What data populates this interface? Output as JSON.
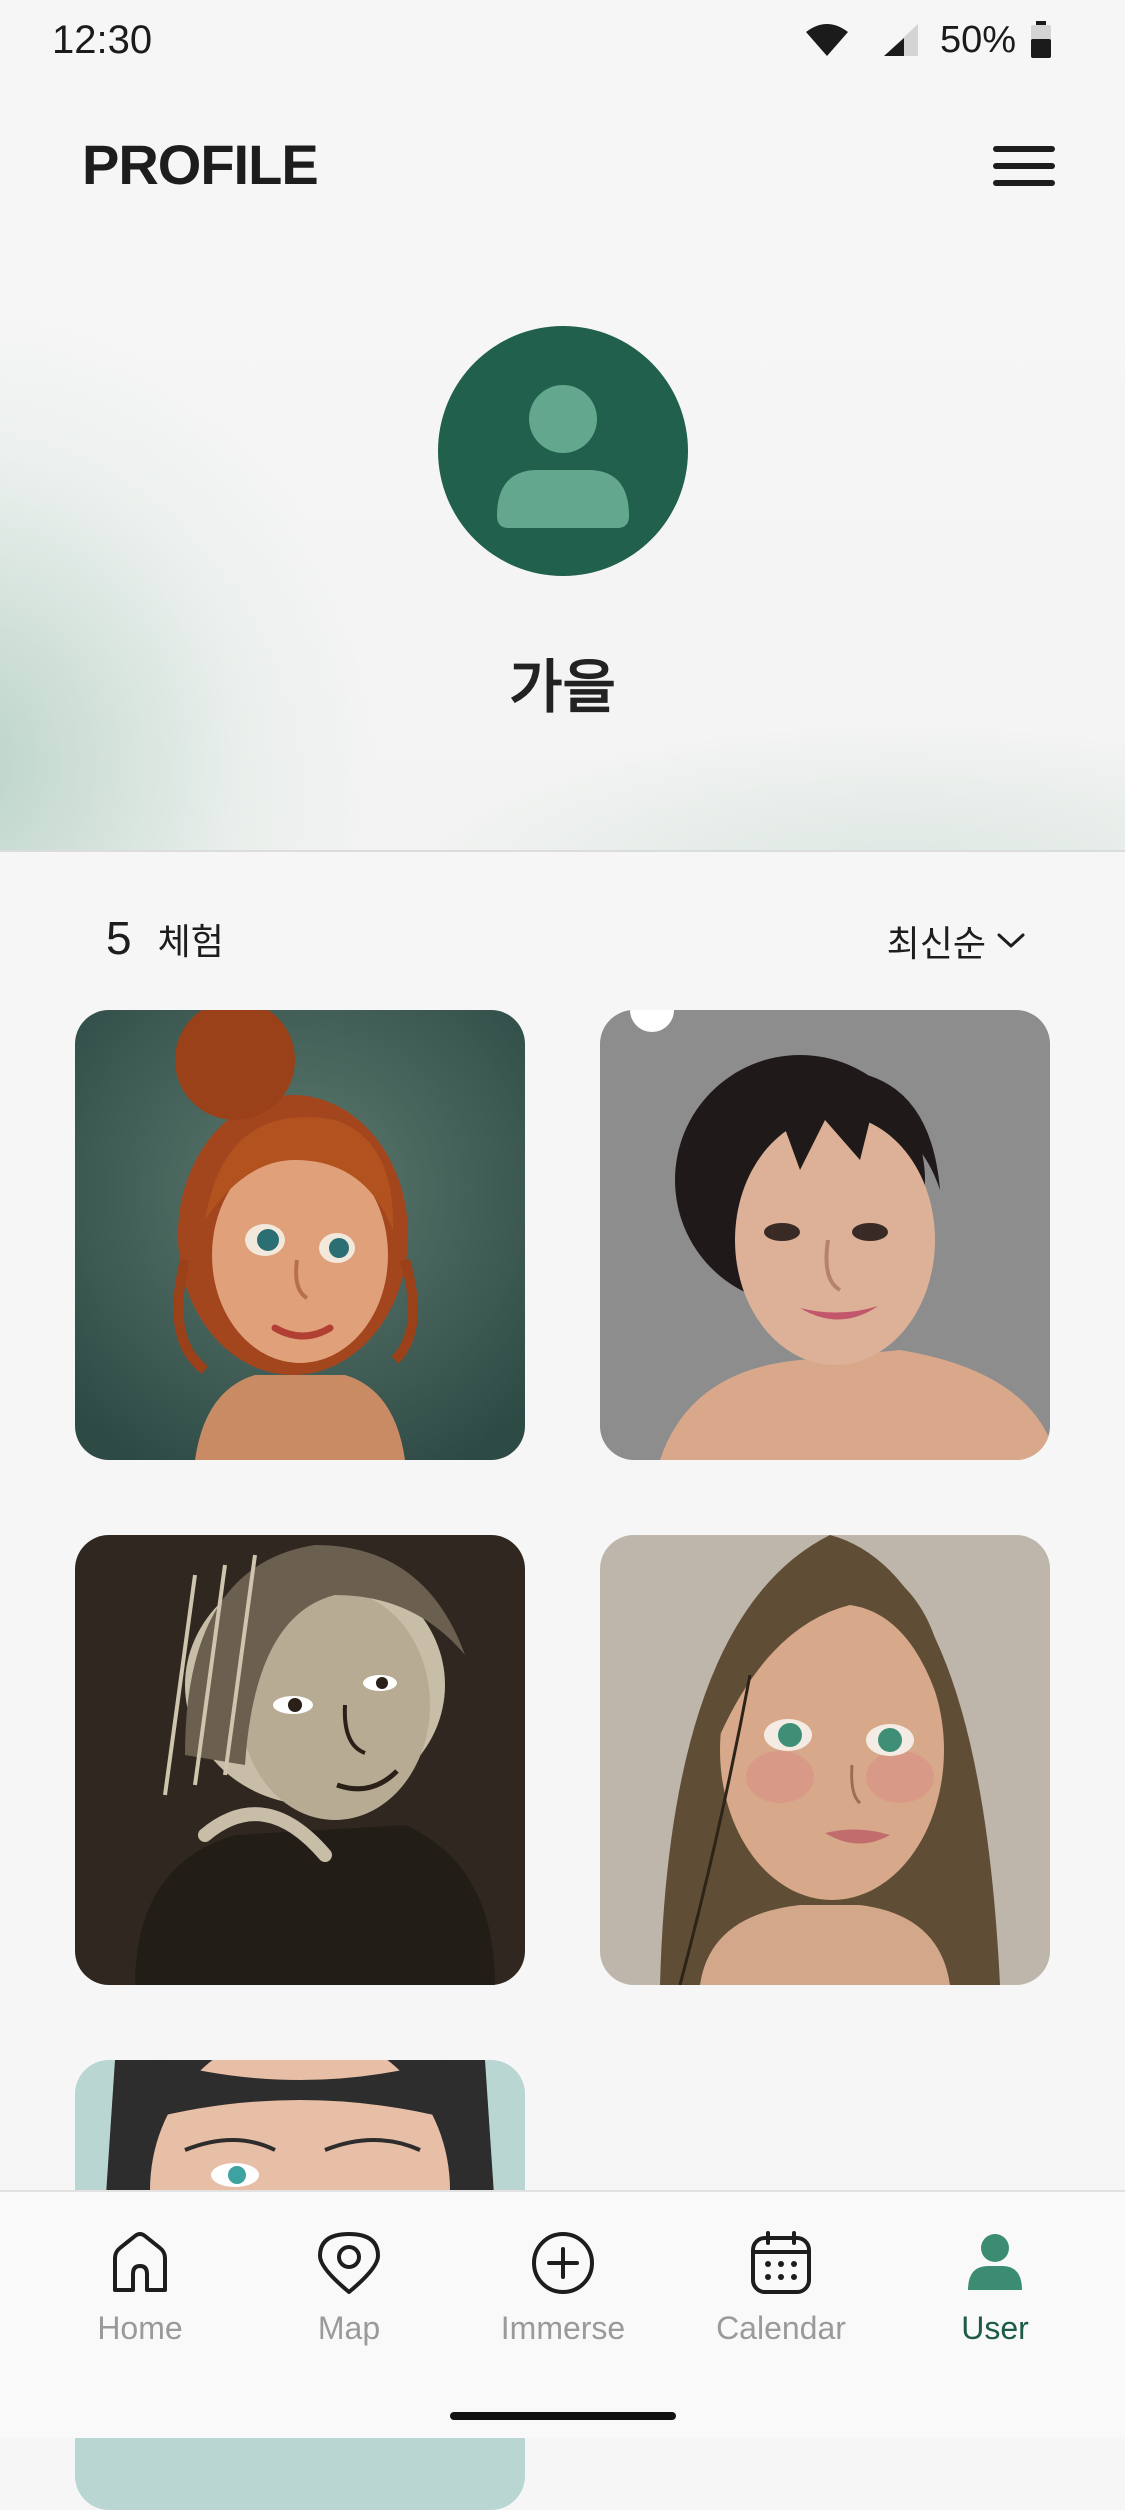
{
  "status_bar": {
    "time": "12:30",
    "battery": "50%",
    "icons": [
      "wifi-icon",
      "cellular-icon",
      "battery-icon"
    ]
  },
  "header": {
    "title": "PROFILE",
    "menu_icon": "hamburger-menu-icon"
  },
  "profile": {
    "name": "가을",
    "avatar_icon": "person-icon",
    "colors": {
      "avatar_bg": "#20604c",
      "avatar_fg": "#63a88e"
    }
  },
  "experiences": {
    "count": "5",
    "label": "체험",
    "sort_label": "최신순",
    "sort_icon": "chevron-down-icon",
    "cards": [
      {
        "name": "illustrated portrait - red hair bun"
      },
      {
        "name": "photo-style portrait - dark bangs"
      },
      {
        "name": "sketch portrait - dark brown"
      },
      {
        "name": "cartoon portrait - long brown hair"
      },
      {
        "name": "line-art portrait - black hair"
      }
    ]
  },
  "bottom_nav": {
    "items": [
      {
        "label": "Home",
        "icon": "home-icon"
      },
      {
        "label": "Map",
        "icon": "map-pin-icon"
      },
      {
        "label": "Immerse",
        "icon": "plus-circle-icon"
      },
      {
        "label": "Calendar",
        "icon": "calendar-icon"
      },
      {
        "label": "User",
        "icon": "user-icon",
        "active": true
      }
    ],
    "colors": {
      "active": "#1e5a48",
      "inactive": "#9a9a9a"
    }
  }
}
